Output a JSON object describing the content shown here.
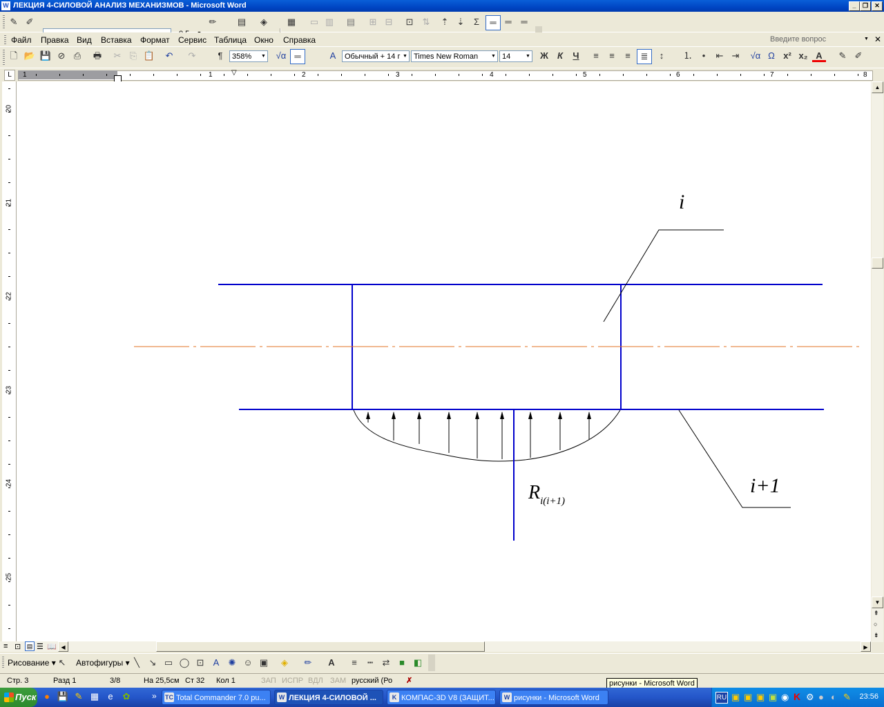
{
  "window": {
    "title": "ЛЕКЦИЯ 4-СИЛОВОЙ АНАЛИЗ МЕХАНИЗМОВ - Microsoft Word",
    "app_icon": "W"
  },
  "toolbar1": {
    "line_weight": "0,5"
  },
  "menu": {
    "items": [
      "Файл",
      "Правка",
      "Вид",
      "Вставка",
      "Формат",
      "Сервис",
      "Таблица",
      "Окно",
      "Справка"
    ],
    "help_placeholder": "Введите вопрос"
  },
  "format_toolbar": {
    "zoom": "358%",
    "style": "Обычный + 14 г",
    "font": "Times New Roman",
    "size": "14",
    "bold": "Ж",
    "italic": "К",
    "underline": "Ч",
    "omega": "Ω",
    "superscript": "x²",
    "subscript": "x₂"
  },
  "ruler": {
    "h_numbers": [
      "1",
      "1",
      "2",
      "3",
      "4",
      "5",
      "6",
      "7",
      "8"
    ],
    "v_numbers": [
      "20",
      "21",
      "22",
      "23",
      "24",
      "25"
    ]
  },
  "drawing": {
    "label_i": "i",
    "label_i1": "i+1",
    "label_R": "R",
    "label_R_sub": "i(i+1)"
  },
  "draw_toolbar": {
    "drawing": "Рисование",
    "autoshapes": "Автофигуры"
  },
  "status": {
    "page": "Стр. 3",
    "section": "Разд 1",
    "pages": "3/8",
    "at": "На 25,5см",
    "line": "Ст 32",
    "col": "Кол 1",
    "rec": "ЗАП",
    "trk": "ИСПР",
    "ext": "ВДЛ",
    "ovr": "ЗАМ",
    "lang": "русский (Ро"
  },
  "tooltip": "рисунки - Microsoft Word",
  "taskbar": {
    "start": "Пуск",
    "tasks": [
      {
        "label": "Total Commander 7.0 pu...",
        "icon": "TC"
      },
      {
        "label": "ЛЕКЦИЯ 4-СИЛОВОЙ ...",
        "icon": "W"
      },
      {
        "label": "КОМПАС-3D V8 (ЗАЩИТ...",
        "icon": "K"
      },
      {
        "label": "рисунки - Microsoft Word",
        "icon": "W"
      }
    ],
    "lang": "RU",
    "clock": "23:56"
  },
  "colors": {
    "blue_line": "#0000cc",
    "axis_line": "#e07020",
    "titlebar": "#0a5fd8"
  }
}
